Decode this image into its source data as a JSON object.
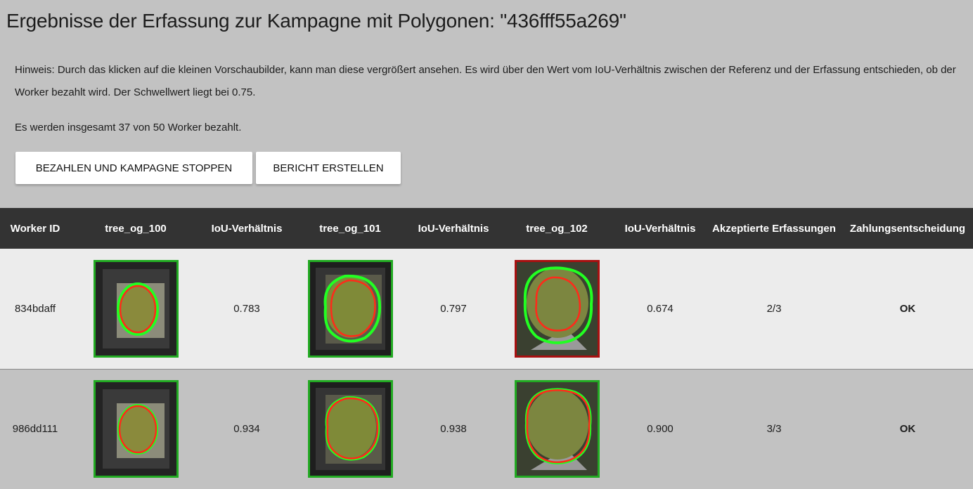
{
  "page": {
    "title": "Ergebnisse der Erfassung zur Kampagne mit Polygonen: \"436fff55a269\"",
    "hint": "Hinweis: Durch das klicken auf die kleinen Vorschaubilder, kann man diese vergrößert ansehen. Es wird über den Wert vom IoU-Verhältnis zwischen der Referenz und der Erfassung entschieden, ob der Worker bezahlt wird. Der Schwellwert liegt bei 0.75.",
    "summary": "Es werden insgesamt 37 von 50 Worker bezahlt."
  },
  "buttons": {
    "pay_and_stop": "BEZAHLEN UND KAMPAGNE STOPPEN",
    "create_report": "BERICHT ERSTELLEN"
  },
  "table": {
    "headers": [
      "Worker ID",
      "tree_og_100",
      "IoU-Verhältnis",
      "tree_og_101",
      "IoU-Verhältnis",
      "tree_og_102",
      "IoU-Verhältnis",
      "Akzeptierte Erfassungen",
      "Zahlungsentscheidung"
    ],
    "rows": [
      {
        "worker_id": "834bdaff",
        "iou_100": "0.783",
        "iou_101": "0.797",
        "iou_102": "0.674",
        "accepted": "2/3",
        "decision": "OK"
      },
      {
        "worker_id": "986dd111",
        "iou_100": "0.934",
        "iou_101": "0.938",
        "iou_102": "0.900",
        "accepted": "3/3",
        "decision": "OK"
      }
    ]
  },
  "colors": {
    "accepted_border": "#22aa22",
    "rejected_border": "#a81010",
    "reference_outline": "#ff2a1a",
    "worker_outline": "#22ff22",
    "ok_text": "#1aa31a",
    "header_bg": "#333333"
  }
}
